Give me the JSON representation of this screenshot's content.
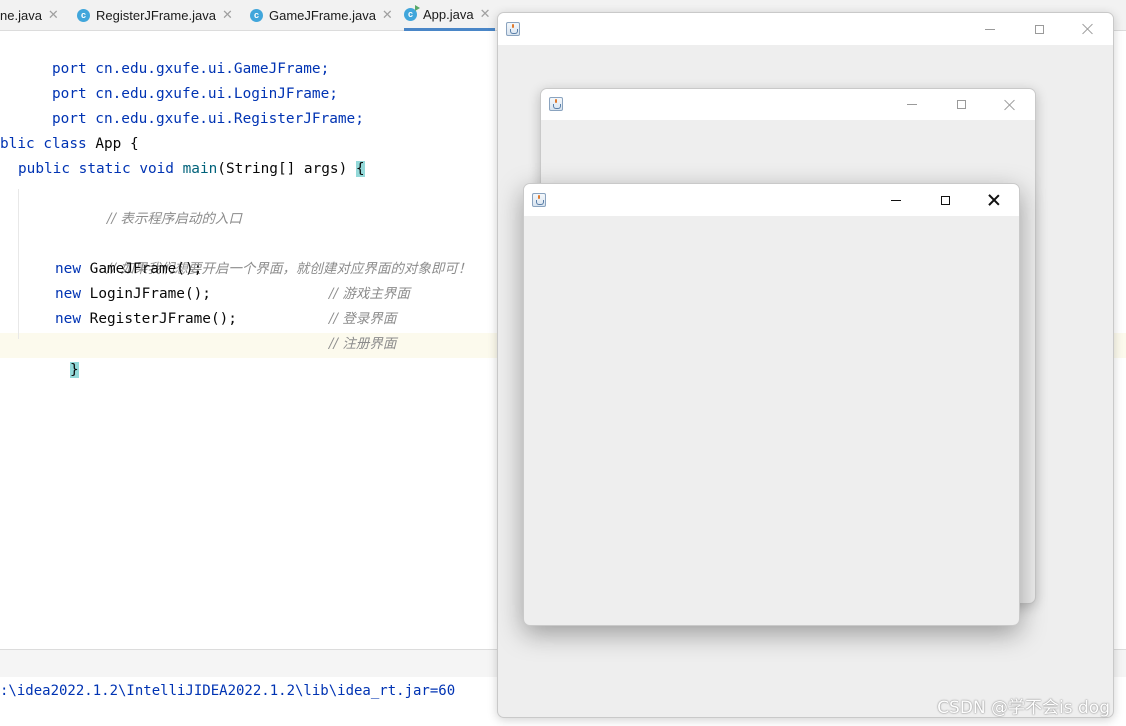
{
  "ide": {
    "tabs": [
      {
        "label": "ne.java",
        "icon": "none"
      },
      {
        "label": "RegisterJFrame.java",
        "icon": "class-icon"
      },
      {
        "label": "GameJFrame.java",
        "icon": "class-icon"
      },
      {
        "label": "App.java",
        "icon": "runnable-class-icon",
        "active": true
      }
    ],
    "code": {
      "imports": [
        "port cn.edu.gxufe.ui.GameJFrame;",
        "port cn.edu.gxufe.ui.LoginJFrame;",
        "port cn.edu.gxufe.ui.RegisterJFrame;"
      ],
      "class_kw1": "blic",
      "class_kw2": "class",
      "class_name": "App {",
      "main_kw1": "public",
      "main_kw2": "static",
      "main_kw3": "void",
      "main_fn": "main",
      "main_args": "(String[] args) ",
      "open_brace": "{",
      "comment1": "// 表示程序启动的入口",
      "comment2": "// 如果我们想要开启一个界面，就创建对应界面的对象即可！",
      "new_kw": "new",
      "stmts": [
        {
          "call": " GameJFrame();",
          "comment": "// 游戏主界面"
        },
        {
          "call": " LoginJFrame();",
          "comment": "// 登录界面"
        },
        {
          "call": " RegisterJFrame();",
          "comment": "// 注册界面"
        }
      ],
      "close_brace": "}"
    },
    "console": ":\\idea2022.1.2\\IntelliJIDEA2022.1.2\\lib\\idea_rt.jar=60"
  },
  "windows": [
    {
      "name": "back-window",
      "state": "inactive"
    },
    {
      "name": "middle-window",
      "state": "inactive"
    },
    {
      "name": "front-window",
      "state": "active"
    }
  ],
  "watermark": "CSDN @学不会is dog",
  "colors": {
    "keyword": "#0033b3",
    "function": "#00627a",
    "comment": "#8c8c8c",
    "tab_accent": "#4a86c7"
  }
}
